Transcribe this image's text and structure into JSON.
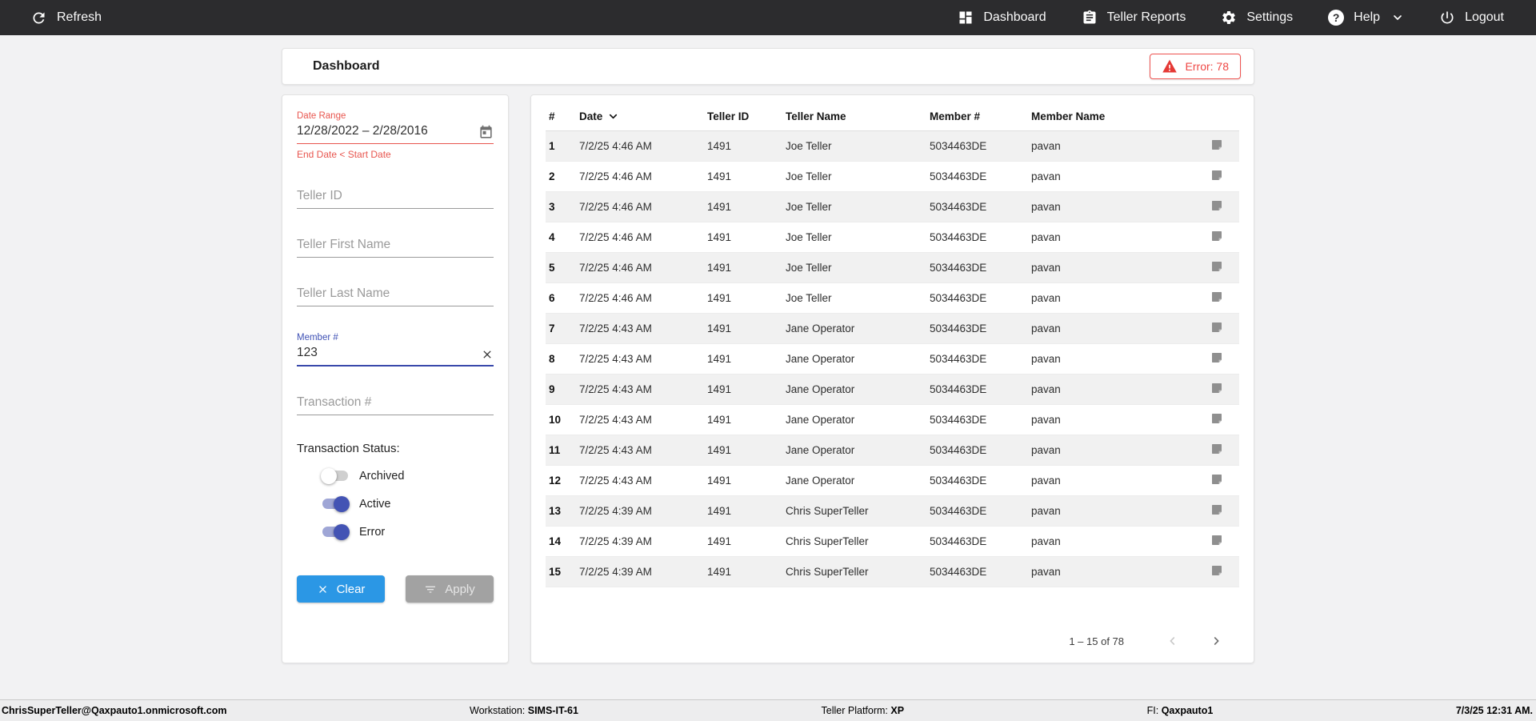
{
  "topbar": {
    "refresh_label": "Refresh",
    "nav": [
      {
        "label": "Dashboard",
        "icon": "dashboard-icon"
      },
      {
        "label": "Teller Reports",
        "icon": "clipboard-icon"
      },
      {
        "label": "Settings",
        "icon": "gear-icon"
      },
      {
        "label": "Help",
        "icon": "help-icon"
      },
      {
        "label": "Logout",
        "icon": "power-icon"
      }
    ]
  },
  "header": {
    "title": "Dashboard",
    "error_badge": "Error: 78"
  },
  "filters": {
    "date_range": {
      "label": "Date Range",
      "value": "12/28/2022 – 2/28/2016",
      "error": "End Date < Start Date"
    },
    "teller_id_placeholder": "Teller ID",
    "teller_first_name_placeholder": "Teller First Name",
    "teller_last_name_placeholder": "Teller Last Name",
    "member_number": {
      "label": "Member #",
      "value": "123"
    },
    "transaction_number_placeholder": "Transaction #",
    "status": {
      "label": "Transaction Status:",
      "toggles": [
        {
          "label": "Archived",
          "on": false
        },
        {
          "label": "Active",
          "on": true
        },
        {
          "label": "Error",
          "on": true
        }
      ]
    },
    "clear_label": "Clear",
    "apply_label": "Apply"
  },
  "table": {
    "columns": [
      "#",
      "Date",
      "Teller ID",
      "Teller Name",
      "Member #",
      "Member Name"
    ],
    "sort_column": "Date",
    "sort_direction": "desc",
    "rows": [
      [
        "1",
        "7/2/25 4:46 AM",
        "1491",
        "Joe Teller",
        "5034463DE",
        "pavan"
      ],
      [
        "2",
        "7/2/25 4:46 AM",
        "1491",
        "Joe Teller",
        "5034463DE",
        "pavan"
      ],
      [
        "3",
        "7/2/25 4:46 AM",
        "1491",
        "Joe Teller",
        "5034463DE",
        "pavan"
      ],
      [
        "4",
        "7/2/25 4:46 AM",
        "1491",
        "Joe Teller",
        "5034463DE",
        "pavan"
      ],
      [
        "5",
        "7/2/25 4:46 AM",
        "1491",
        "Joe Teller",
        "5034463DE",
        "pavan"
      ],
      [
        "6",
        "7/2/25 4:46 AM",
        "1491",
        "Joe Teller",
        "5034463DE",
        "pavan"
      ],
      [
        "7",
        "7/2/25 4:43 AM",
        "1491",
        "Jane Operator",
        "5034463DE",
        "pavan"
      ],
      [
        "8",
        "7/2/25 4:43 AM",
        "1491",
        "Jane Operator",
        "5034463DE",
        "pavan"
      ],
      [
        "9",
        "7/2/25 4:43 AM",
        "1491",
        "Jane Operator",
        "5034463DE",
        "pavan"
      ],
      [
        "10",
        "7/2/25 4:43 AM",
        "1491",
        "Jane Operator",
        "5034463DE",
        "pavan"
      ],
      [
        "11",
        "7/2/25 4:43 AM",
        "1491",
        "Jane Operator",
        "5034463DE",
        "pavan"
      ],
      [
        "12",
        "7/2/25 4:43 AM",
        "1491",
        "Jane Operator",
        "5034463DE",
        "pavan"
      ],
      [
        "13",
        "7/2/25 4:39 AM",
        "1491",
        "Chris SuperTeller",
        "5034463DE",
        "pavan"
      ],
      [
        "14",
        "7/2/25 4:39 AM",
        "1491",
        "Chris SuperTeller",
        "5034463DE",
        "pavan"
      ],
      [
        "15",
        "7/2/25 4:39 AM",
        "1491",
        "Chris SuperTeller",
        "5034463DE",
        "pavan"
      ]
    ],
    "pagination": {
      "range_label": "1 – 15 of 78"
    }
  },
  "footer": {
    "user": "ChrisSuperTeller@Qaxpauto1.onmicrosoft.com",
    "workstation_label": "Workstation: ",
    "workstation": "SIMS-IT-61",
    "platform_label": "Teller Platform: ",
    "platform": "XP",
    "fi_label": "FI: ",
    "fi": "Qaxpauto1",
    "datetime": "7/3/25 12:31 AM."
  },
  "colors": {
    "topbar_dark": "#2c2c2e",
    "error_red": "#e8554e",
    "accent_indigo": "#3f51b5",
    "clear_blue": "#2b97e5",
    "apply_gray": "#a2a2a2"
  }
}
